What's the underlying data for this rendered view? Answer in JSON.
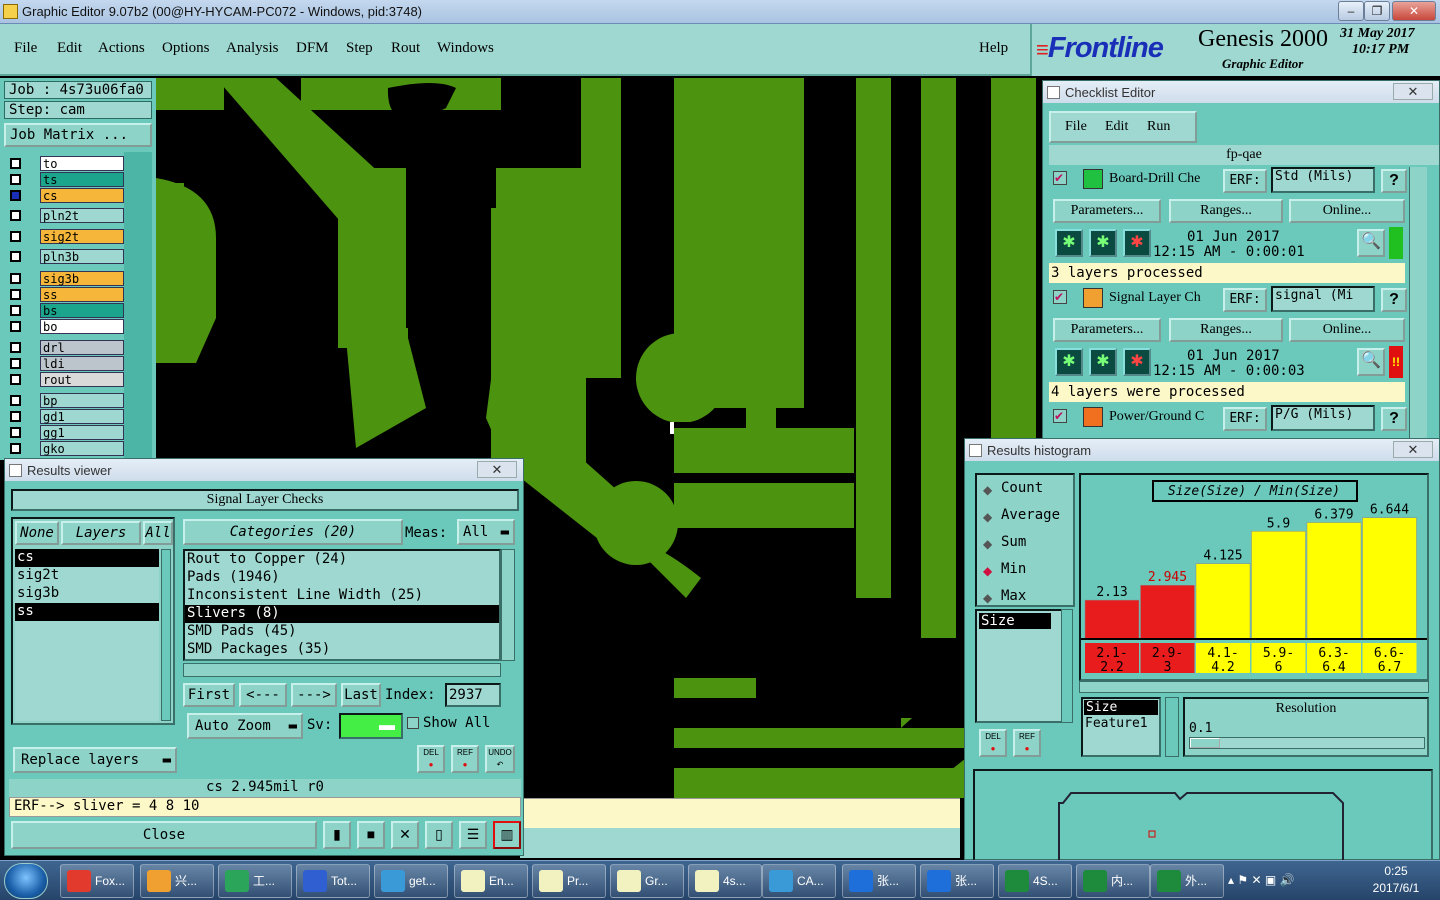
{
  "window": {
    "title": "Graphic Editor 9.07b2 (00@HY-HYCAM-PC072 - Windows, pid:3748)"
  },
  "menu": [
    "File",
    "Edit",
    "Actions",
    "Options",
    "Analysis",
    "DFM",
    "Step",
    "Rout",
    "Windows"
  ],
  "help": "Help",
  "brand": {
    "logo": "Frontline",
    "product": "Genesis 2000",
    "subtitle": "Graphic Editor",
    "date": "31 May 2017",
    "time": "10:17 PM"
  },
  "job": {
    "job": "Job : 4s73u06fa0",
    "step": "Step: cam",
    "matrix": "Job Matrix ..."
  },
  "layers": [
    {
      "name": "to",
      "color": "#ffffff"
    },
    {
      "name": "ts",
      "color": "#1aa58c"
    },
    {
      "name": "cs",
      "color": "#f5b63a"
    },
    {
      "name": "pln2t",
      "color": "#9ed8d0"
    },
    {
      "name": "sig2t",
      "color": "#f5b63a"
    },
    {
      "name": "pln3b",
      "color": "#9ed8d0"
    },
    {
      "name": "sig3b",
      "color": "#f5b63a"
    },
    {
      "name": "ss",
      "color": "#f5b63a"
    },
    {
      "name": "bs",
      "color": "#1aa58c"
    },
    {
      "name": "bo",
      "color": "#ffffff"
    },
    {
      "name": "drl",
      "color": "#bcc4cc"
    },
    {
      "name": "ldi",
      "color": "#bcc4cc"
    },
    {
      "name": "rout",
      "color": "#d9d9d9"
    },
    {
      "name": "bp",
      "color": "#9ed8d0"
    },
    {
      "name": "gd1",
      "color": "#9ed8d0"
    },
    {
      "name": "gg1",
      "color": "#9ed8d0"
    },
    {
      "name": "gko",
      "color": "#9ed8d0"
    }
  ],
  "checklist": {
    "title": "Checklist Editor",
    "menu": [
      "File",
      "Edit",
      "Run"
    ],
    "name": "fp-qae",
    "erf_label": "ERF:",
    "params": "Parameters...",
    "ranges": "Ranges...",
    "online": "Online...",
    "items": [
      {
        "name": "Board-Drill Che",
        "erf": "Std (Mils)",
        "date": "01 Jun 2017",
        "time": "12:15 AM - 0:00:01",
        "status": "3 layers processed",
        "flag": "",
        "flagcolor": "#20c020"
      },
      {
        "name": "Signal Layer Ch",
        "erf": "signal (Mi",
        "date": "01 Jun 2017",
        "time": "12:15 AM - 0:00:03",
        "status": "4 layers were processed",
        "flag": "!!",
        "flagcolor": "#e01010"
      },
      {
        "name": "Power/Ground C",
        "erf": "P/G (Mils)",
        "date": "",
        "time": "",
        "status": "",
        "flag": "",
        "flagcolor": ""
      }
    ]
  },
  "results": {
    "title": "Results viewer",
    "header": "Signal Layer Checks",
    "none": "None",
    "layers_label": "Layers",
    "all": "All",
    "categories_label": "Categories (20)",
    "meas_label": "Meas:",
    "meas_value": "All",
    "layer_list": [
      "cs",
      "sig2t",
      "sig3b",
      "ss"
    ],
    "categories": [
      "Rout to Copper (24)",
      "Pads (1946)",
      "Inconsistent Line Width (25)",
      "Slivers (8)",
      "SMD Pads (45)",
      "SMD Packages (35)"
    ],
    "nav": [
      "First",
      "<---",
      "--->",
      "Last"
    ],
    "index_label": "Index:",
    "index_value": "2937",
    "autozoom": "Auto Zoom",
    "sv": "Sv:",
    "show_all": "Show All",
    "replace": "Replace layers",
    "status": "cs 2.945mil  r0",
    "erf_line": "ERF--> sliver = 4 8 10",
    "close": "Close",
    "icons": [
      "DEL",
      "REF",
      "UNDO"
    ]
  },
  "histogram": {
    "title": "Results histogram",
    "modes": [
      "Count",
      "Average",
      "Sum",
      "Min",
      "Max"
    ],
    "selected_mode": "Min",
    "size_label": "Size",
    "size2": "Size",
    "feature": "Feature1",
    "resolution_label": "Resolution",
    "resolution": "0.1",
    "del": "DEL",
    "ref": "REF"
  },
  "chart_data": {
    "type": "bar",
    "title": "Size(Size) / Min(Size)",
    "categories": [
      "2.1-2.2",
      "2.9-3",
      "4.1-4.2",
      "5.9-6",
      "6.3-6.4",
      "6.6-6.7"
    ],
    "values": [
      2.13,
      2.945,
      4.125,
      5.9,
      6.379,
      6.644
    ],
    "value_labels": [
      "2.13",
      "2.945",
      "4.125",
      "5.9",
      "6.379",
      "6.644"
    ],
    "colors": [
      "#e81c1c",
      "#e81c1c",
      "#ffff00",
      "#ffff00",
      "#ffff00",
      "#ffff00"
    ],
    "label_colors": [
      "#000000",
      "#cc0000",
      "#000000",
      "#000000",
      "#000000",
      "#000000"
    ],
    "ylim": [
      0,
      6.9
    ]
  },
  "taskbar": {
    "items": [
      {
        "label": "Fox...",
        "color": "#e23b2e"
      },
      {
        "label": "兴...",
        "color": "#f0a030"
      },
      {
        "label": "工...",
        "color": "#2aa55a"
      },
      {
        "label": "Tot...",
        "color": "#2f5fd0"
      },
      {
        "label": "get...",
        "color": "#3a9ad8"
      },
      {
        "label": "En...",
        "color": "#f2f2c0"
      },
      {
        "label": "Pr...",
        "color": "#f2f2c0"
      },
      {
        "label": "Gr...",
        "color": "#f2f2c0"
      },
      {
        "label": "4s...",
        "color": "#f2f2c0"
      },
      {
        "label": "CA...",
        "color": "#3a9ad8"
      },
      {
        "label": "张...",
        "color": "#1e6fd9"
      },
      {
        "label": "张...",
        "color": "#1e6fd9"
      },
      {
        "label": "4S...",
        "color": "#1e8a3c"
      },
      {
        "label": "内...",
        "color": "#1e8a3c"
      },
      {
        "label": "外...",
        "color": "#1e8a3c"
      }
    ],
    "time": "0:25",
    "date": "2017/6/1"
  }
}
